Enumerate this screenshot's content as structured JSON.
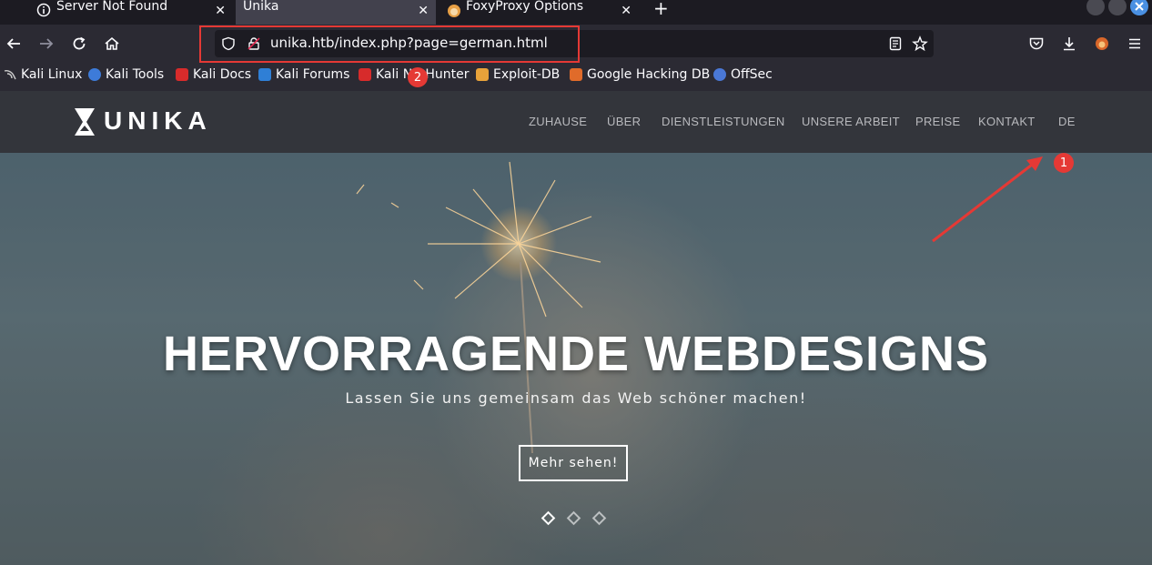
{
  "browser": {
    "tabs": [
      {
        "label": "Server Not Found",
        "icon": "info-icon"
      },
      {
        "label": "Unika",
        "icon": null
      },
      {
        "label": "FoxyProxy Options",
        "icon": "foxyproxy-icon"
      }
    ],
    "new_tab_glyph": "+",
    "close_glyph": "✕",
    "url": "unika.htb/index.php?page=german.html",
    "bookmarks": [
      {
        "label": "Kali Linux",
        "icon": "kali-dragon-icon",
        "color": "#cccccc"
      },
      {
        "label": "Kali Tools",
        "icon": "kali-tools-icon",
        "color": "#3d7bd9"
      },
      {
        "label": "Kali Docs",
        "icon": "kali-docs-icon",
        "color": "#d72b2b"
      },
      {
        "label": "Kali Forums",
        "icon": "kali-forums-icon",
        "color": "#2f7fd6"
      },
      {
        "label": "Kali NetHunter",
        "icon": "kali-nethunter-icon",
        "color": "#d72b2b"
      },
      {
        "label": "Exploit-DB",
        "icon": "exploit-db-icon",
        "color": "#e8a23a"
      },
      {
        "label": "Google Hacking DB",
        "icon": "ghdb-icon",
        "color": "#e06b2a"
      },
      {
        "label": "OffSec",
        "icon": "offsec-icon",
        "color": "#4a78d6"
      }
    ]
  },
  "annotations": {
    "badge_1": "1",
    "badge_2": "2",
    "color": "#e53935"
  },
  "site": {
    "logo": "UNIKA",
    "nav": [
      "ZUHAUSE",
      "ÜBER",
      "DIENSTLEISTUNGEN",
      "UNSERE ARBEIT",
      "PREISE",
      "KONTAKT",
      "DE"
    ],
    "hero": {
      "headline": "HERVORRAGENDE WEBDESIGNS",
      "subline": "Lassen Sie uns gemeinsam das Web schöner machen!",
      "button": "Mehr sehen!"
    }
  }
}
